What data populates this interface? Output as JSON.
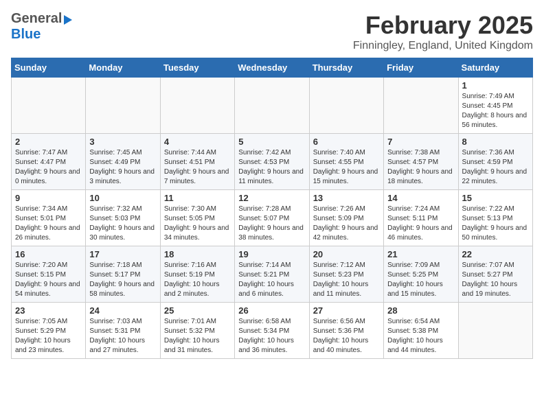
{
  "header": {
    "logo_general": "General",
    "logo_blue": "Blue",
    "month_title": "February 2025",
    "location": "Finningley, England, United Kingdom"
  },
  "weekdays": [
    "Sunday",
    "Monday",
    "Tuesday",
    "Wednesday",
    "Thursday",
    "Friday",
    "Saturday"
  ],
  "weeks": [
    [
      {
        "day": "",
        "info": ""
      },
      {
        "day": "",
        "info": ""
      },
      {
        "day": "",
        "info": ""
      },
      {
        "day": "",
        "info": ""
      },
      {
        "day": "",
        "info": ""
      },
      {
        "day": "",
        "info": ""
      },
      {
        "day": "1",
        "info": "Sunrise: 7:49 AM\nSunset: 4:45 PM\nDaylight: 8 hours and 56 minutes."
      }
    ],
    [
      {
        "day": "2",
        "info": "Sunrise: 7:47 AM\nSunset: 4:47 PM\nDaylight: 9 hours and 0 minutes."
      },
      {
        "day": "3",
        "info": "Sunrise: 7:45 AM\nSunset: 4:49 PM\nDaylight: 9 hours and 3 minutes."
      },
      {
        "day": "4",
        "info": "Sunrise: 7:44 AM\nSunset: 4:51 PM\nDaylight: 9 hours and 7 minutes."
      },
      {
        "day": "5",
        "info": "Sunrise: 7:42 AM\nSunset: 4:53 PM\nDaylight: 9 hours and 11 minutes."
      },
      {
        "day": "6",
        "info": "Sunrise: 7:40 AM\nSunset: 4:55 PM\nDaylight: 9 hours and 15 minutes."
      },
      {
        "day": "7",
        "info": "Sunrise: 7:38 AM\nSunset: 4:57 PM\nDaylight: 9 hours and 18 minutes."
      },
      {
        "day": "8",
        "info": "Sunrise: 7:36 AM\nSunset: 4:59 PM\nDaylight: 9 hours and 22 minutes."
      }
    ],
    [
      {
        "day": "9",
        "info": "Sunrise: 7:34 AM\nSunset: 5:01 PM\nDaylight: 9 hours and 26 minutes."
      },
      {
        "day": "10",
        "info": "Sunrise: 7:32 AM\nSunset: 5:03 PM\nDaylight: 9 hours and 30 minutes."
      },
      {
        "day": "11",
        "info": "Sunrise: 7:30 AM\nSunset: 5:05 PM\nDaylight: 9 hours and 34 minutes."
      },
      {
        "day": "12",
        "info": "Sunrise: 7:28 AM\nSunset: 5:07 PM\nDaylight: 9 hours and 38 minutes."
      },
      {
        "day": "13",
        "info": "Sunrise: 7:26 AM\nSunset: 5:09 PM\nDaylight: 9 hours and 42 minutes."
      },
      {
        "day": "14",
        "info": "Sunrise: 7:24 AM\nSunset: 5:11 PM\nDaylight: 9 hours and 46 minutes."
      },
      {
        "day": "15",
        "info": "Sunrise: 7:22 AM\nSunset: 5:13 PM\nDaylight: 9 hours and 50 minutes."
      }
    ],
    [
      {
        "day": "16",
        "info": "Sunrise: 7:20 AM\nSunset: 5:15 PM\nDaylight: 9 hours and 54 minutes."
      },
      {
        "day": "17",
        "info": "Sunrise: 7:18 AM\nSunset: 5:17 PM\nDaylight: 9 hours and 58 minutes."
      },
      {
        "day": "18",
        "info": "Sunrise: 7:16 AM\nSunset: 5:19 PM\nDaylight: 10 hours and 2 minutes."
      },
      {
        "day": "19",
        "info": "Sunrise: 7:14 AM\nSunset: 5:21 PM\nDaylight: 10 hours and 6 minutes."
      },
      {
        "day": "20",
        "info": "Sunrise: 7:12 AM\nSunset: 5:23 PM\nDaylight: 10 hours and 11 minutes."
      },
      {
        "day": "21",
        "info": "Sunrise: 7:09 AM\nSunset: 5:25 PM\nDaylight: 10 hours and 15 minutes."
      },
      {
        "day": "22",
        "info": "Sunrise: 7:07 AM\nSunset: 5:27 PM\nDaylight: 10 hours and 19 minutes."
      }
    ],
    [
      {
        "day": "23",
        "info": "Sunrise: 7:05 AM\nSunset: 5:29 PM\nDaylight: 10 hours and 23 minutes."
      },
      {
        "day": "24",
        "info": "Sunrise: 7:03 AM\nSunset: 5:31 PM\nDaylight: 10 hours and 27 minutes."
      },
      {
        "day": "25",
        "info": "Sunrise: 7:01 AM\nSunset: 5:32 PM\nDaylight: 10 hours and 31 minutes."
      },
      {
        "day": "26",
        "info": "Sunrise: 6:58 AM\nSunset: 5:34 PM\nDaylight: 10 hours and 36 minutes."
      },
      {
        "day": "27",
        "info": "Sunrise: 6:56 AM\nSunset: 5:36 PM\nDaylight: 10 hours and 40 minutes."
      },
      {
        "day": "28",
        "info": "Sunrise: 6:54 AM\nSunset: 5:38 PM\nDaylight: 10 hours and 44 minutes."
      },
      {
        "day": "",
        "info": ""
      }
    ]
  ]
}
